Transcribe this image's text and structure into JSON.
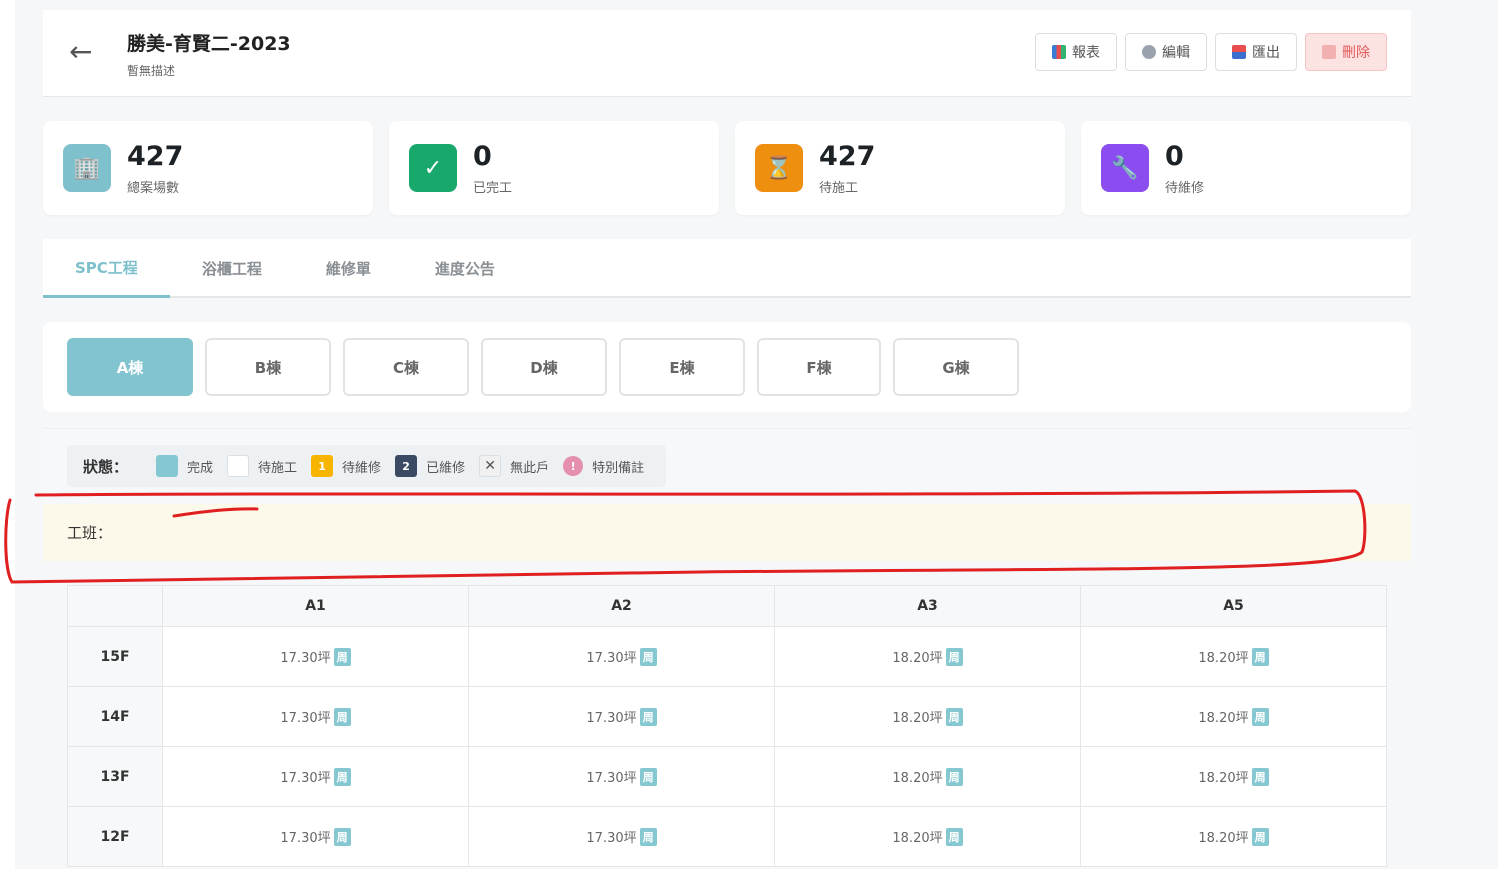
{
  "header": {
    "title": "勝美-育賢二-2023",
    "subtitle": "暫無描述",
    "back_icon": "←",
    "buttons": {
      "report": "報表",
      "edit": "編輯",
      "export": "匯出",
      "delete": "刪除"
    }
  },
  "stats": [
    {
      "value": "427",
      "label": "總案場數",
      "icon": "building-icon",
      "color": "#7ec0cb",
      "glyph": "🏢"
    },
    {
      "value": "0",
      "label": "已完工",
      "icon": "check-icon",
      "color": "#19a86c",
      "glyph": "✓"
    },
    {
      "value": "427",
      "label": "待施工",
      "icon": "hourglass-icon",
      "color": "#ef8f0f",
      "glyph": "⌛"
    },
    {
      "value": "0",
      "label": "待維修",
      "icon": "wrench-icon",
      "color": "#8b4df0",
      "glyph": "🔧"
    }
  ],
  "tabs": [
    "SPC工程",
    "浴櫃工程",
    "維修單",
    "進度公告"
  ],
  "buildings": [
    "A棟",
    "B棟",
    "C棟",
    "D棟",
    "E棟",
    "F棟",
    "G棟"
  ],
  "legend": {
    "label": "狀態：",
    "items": [
      {
        "text": "完成",
        "color": "#86c8d1",
        "mark": ""
      },
      {
        "text": "待施工",
        "color": "#ffffff",
        "mark": ""
      },
      {
        "text": "待維修",
        "color": "#f7b500",
        "mark": "1"
      },
      {
        "text": "已維修",
        "color": "#3b4a63",
        "mark": "2"
      },
      {
        "text": "無此戶",
        "color": "#f0f0f0",
        "mark": "✕"
      },
      {
        "text": "特別備註",
        "color": "#e58fb0",
        "mark": "!"
      }
    ]
  },
  "crew": {
    "label": "工班："
  },
  "grid": {
    "columns": [
      "A1",
      "A2",
      "A3",
      "A5"
    ],
    "tag": "周",
    "rows": [
      {
        "floor": "15F",
        "cells": [
          "17.30坪",
          "17.30坪",
          "18.20坪",
          "18.20坪"
        ]
      },
      {
        "floor": "14F",
        "cells": [
          "17.30坪",
          "17.30坪",
          "18.20坪",
          "18.20坪"
        ]
      },
      {
        "floor": "13F",
        "cells": [
          "17.30坪",
          "17.30坪",
          "18.20坪",
          "18.20坪"
        ]
      },
      {
        "floor": "12F",
        "cells": [
          "17.30坪",
          "17.30坪",
          "18.20坪",
          "18.20坪"
        ]
      }
    ]
  },
  "colors": {
    "accent": "#7ec0cb",
    "danger": "#e05a5a",
    "annotation": "#e02020"
  }
}
